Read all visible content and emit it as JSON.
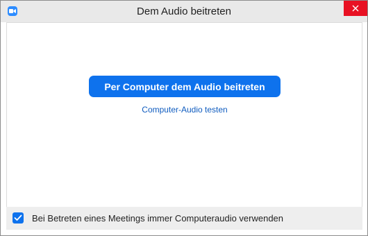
{
  "window": {
    "title": "Dem Audio beitreten"
  },
  "icons": {
    "app": "zoom-camera-icon",
    "close": "close-icon",
    "checkbox": "checkmark-icon"
  },
  "main": {
    "join_button_label": "Per Computer dem Audio beitreten",
    "test_link_label": "Computer-Audio testen"
  },
  "footer": {
    "checkbox_checked": true,
    "checkbox_label": "Bei Betreten eines Meetings immer Computeraudio verwenden"
  },
  "colors": {
    "accent": "#0e72ed",
    "close_button": "#e81123",
    "link": "#0e5bbf"
  }
}
